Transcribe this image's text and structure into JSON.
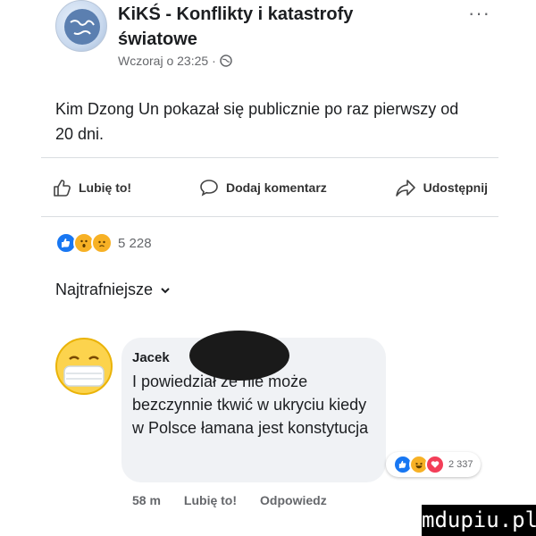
{
  "post": {
    "page_name": "KiKŚ - Konflikty i katastrofy światowe",
    "timestamp": "Wczoraj o 23:25",
    "separator": "·",
    "more": "···",
    "text": "Kim Dzong Un pokazał się publicznie po raz pierwszy od 20 dni."
  },
  "actions": {
    "like": "Lubię to!",
    "comment": "Dodaj komentarz",
    "share": "Udostępnij"
  },
  "reactions": {
    "count": "5 228"
  },
  "comments": {
    "sort_label": "Najtrafniejsze",
    "items": [
      {
        "author": "Jacek",
        "text": "I powiedział że nie może bezczynnie tkwić w ukryciu kiedy w Polsce łamana jest konstytucja",
        "reaction_count": "2 337",
        "time": "58 m",
        "like": "Lubię to!",
        "reply": "Odpowiedz"
      }
    ]
  },
  "watermark": "mdupiu.pl",
  "colors": {
    "like_blue": "#1877f2",
    "haha_yellow": "#f7b125",
    "love_red": "#f33e58",
    "muted": "#65676b"
  }
}
